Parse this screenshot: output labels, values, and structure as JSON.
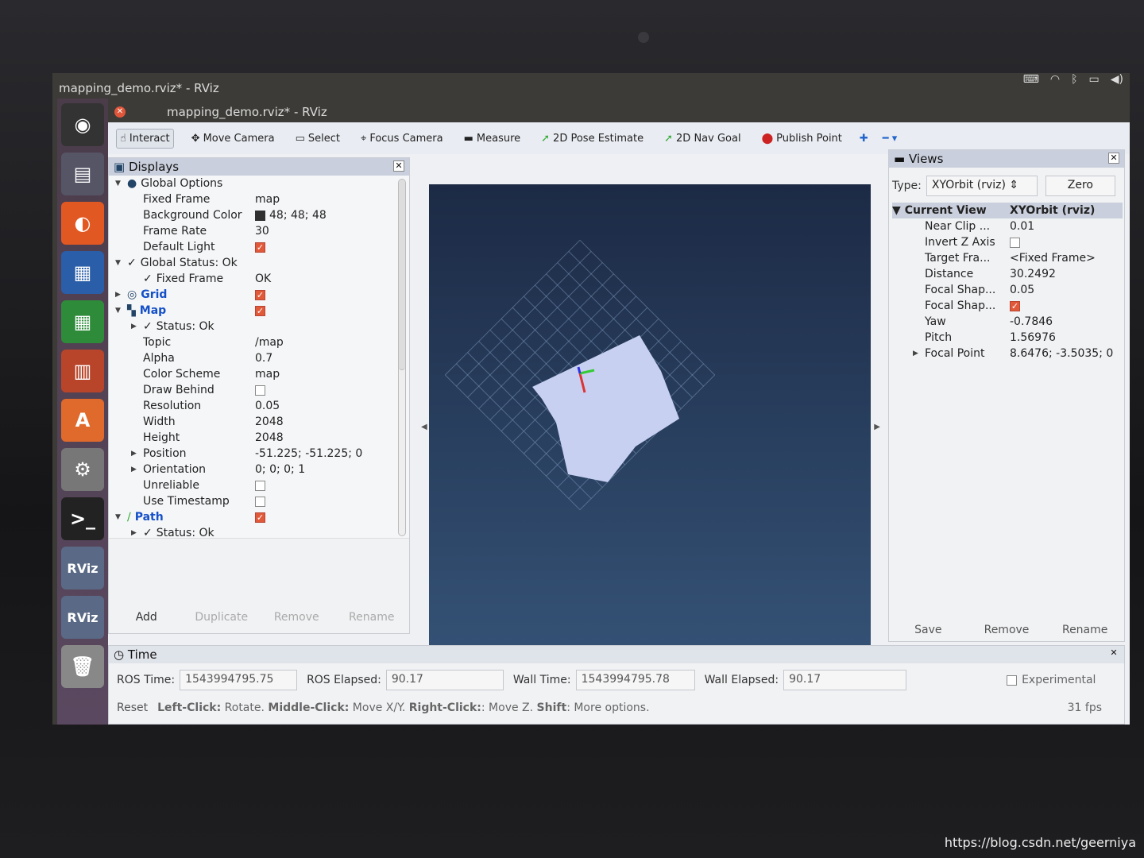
{
  "desktop": {
    "topbar_title": "mapping_demo.rviz* - RViz",
    "tray": [
      "keyboard-icon",
      "wifi-icon",
      "bluetooth-icon",
      "battery-icon",
      "volume-icon"
    ]
  },
  "launcher": [
    "ubuntu-dash",
    "files",
    "firefox",
    "writer",
    "calc",
    "impress",
    "software-center",
    "settings",
    "terminal",
    "rviz",
    "rviz",
    "trash"
  ],
  "window": {
    "title": "mapping_demo.rviz* - RViz"
  },
  "toolbar": [
    {
      "label": "Interact",
      "icon": "hand-icon"
    },
    {
      "label": "Move Camera",
      "icon": "move-camera-icon"
    },
    {
      "label": "Select",
      "icon": "select-icon"
    },
    {
      "label": "Focus Camera",
      "icon": "focus-icon"
    },
    {
      "label": "Measure",
      "icon": "ruler-icon"
    },
    {
      "label": "2D Pose Estimate",
      "icon": "green-arrow-icon"
    },
    {
      "label": "2D Nav Goal",
      "icon": "green-arrow-icon"
    },
    {
      "label": "Publish Point",
      "icon": "pin-icon"
    }
  ],
  "displays": {
    "title": "Displays",
    "rows": [
      {
        "d": 0,
        "e": "▼",
        "icon": "●",
        "label": "Global Options",
        "val": ""
      },
      {
        "d": 1,
        "label": "Fixed Frame",
        "val": "map"
      },
      {
        "d": 1,
        "label": "Background Color",
        "val": "48; 48; 48",
        "sw": true
      },
      {
        "d": 1,
        "label": "Frame Rate",
        "val": "30"
      },
      {
        "d": 1,
        "label": "Default Light",
        "cb": true
      },
      {
        "d": 0,
        "e": "▼",
        "icon": "✓",
        "label": "Global Status: Ok",
        "val": ""
      },
      {
        "d": 1,
        "icon": "✓",
        "label": "Fixed Frame",
        "val": "OK"
      },
      {
        "d": 0,
        "e": "▶",
        "icon": "◎",
        "label": "Grid",
        "blue": true,
        "cb": true
      },
      {
        "d": 0,
        "e": "▼",
        "icon": "▚",
        "label": "Map",
        "blue": true,
        "cb": true
      },
      {
        "d": 1,
        "e": "▶",
        "icon": "✓",
        "label": "Status: Ok",
        "val": ""
      },
      {
        "d": 1,
        "label": "Topic",
        "val": "/map"
      },
      {
        "d": 1,
        "label": "Alpha",
        "val": "0.7"
      },
      {
        "d": 1,
        "label": "Color Scheme",
        "val": "map"
      },
      {
        "d": 1,
        "label": "Draw Behind",
        "cb": false
      },
      {
        "d": 1,
        "label": "Resolution",
        "val": "0.05"
      },
      {
        "d": 1,
        "label": "Width",
        "val": "2048"
      },
      {
        "d": 1,
        "label": "Height",
        "val": "2048"
      },
      {
        "d": 1,
        "e": "▶",
        "label": "Position",
        "val": "-51.225; -51.225; 0"
      },
      {
        "d": 1,
        "e": "▶",
        "label": "Orientation",
        "val": "0; 0; 0; 1"
      },
      {
        "d": 1,
        "label": "Unreliable",
        "cb": false
      },
      {
        "d": 1,
        "label": "Use Timestamp",
        "cb": false
      },
      {
        "d": 0,
        "e": "▼",
        "icon": "∕",
        "label": "Path",
        "blue": true,
        "cb": true
      },
      {
        "d": 1,
        "e": "▶",
        "icon": "✓",
        "label": "Status: Ok",
        "val": ""
      }
    ],
    "buttons": [
      "Add",
      "Duplicate",
      "Remove",
      "Rename"
    ]
  },
  "views": {
    "title": "Views",
    "type_label": "Type:",
    "type_value": "XYOrbit (rviz)",
    "zero": "Zero",
    "header": [
      "Current View",
      "XYOrbit (rviz)"
    ],
    "rows": [
      {
        "label": "Near Clip ...",
        "val": "0.01"
      },
      {
        "label": "Invert Z Axis",
        "cb": false
      },
      {
        "label": "Target Fra...",
        "val": "<Fixed Frame>"
      },
      {
        "label": "Distance",
        "val": "30.2492"
      },
      {
        "label": "Focal Shap...",
        "val": "0.05"
      },
      {
        "label": "Focal Shap...",
        "cb": true
      },
      {
        "label": "Yaw",
        "val": "-0.7846"
      },
      {
        "label": "Pitch",
        "val": "1.56976"
      },
      {
        "label": "Focal Point",
        "val": "8.6476; -3.5035; 0",
        "e": "▶"
      }
    ],
    "buttons": [
      "Save",
      "Remove",
      "Rename"
    ]
  },
  "time": {
    "title": "Time",
    "ros_time_label": "ROS Time:",
    "ros_time": "1543994795.75",
    "ros_elapsed_label": "ROS Elapsed:",
    "ros_elapsed": "90.17",
    "wall_time_label": "Wall Time:",
    "wall_time": "1543994795.78",
    "wall_elapsed_label": "Wall Elapsed:",
    "wall_elapsed": "90.17",
    "experimental": "Experimental"
  },
  "status": {
    "reset": "Reset",
    "hint": [
      [
        "Left-Click:",
        " Rotate. "
      ],
      [
        "Middle-Click:",
        " Move X/Y. "
      ],
      [
        "Right-Click:",
        ": Move Z. "
      ],
      [
        "Shift",
        ": More options."
      ]
    ],
    "fps": "31 fps"
  },
  "watermark": "https://blog.csdn.net/geerniya"
}
